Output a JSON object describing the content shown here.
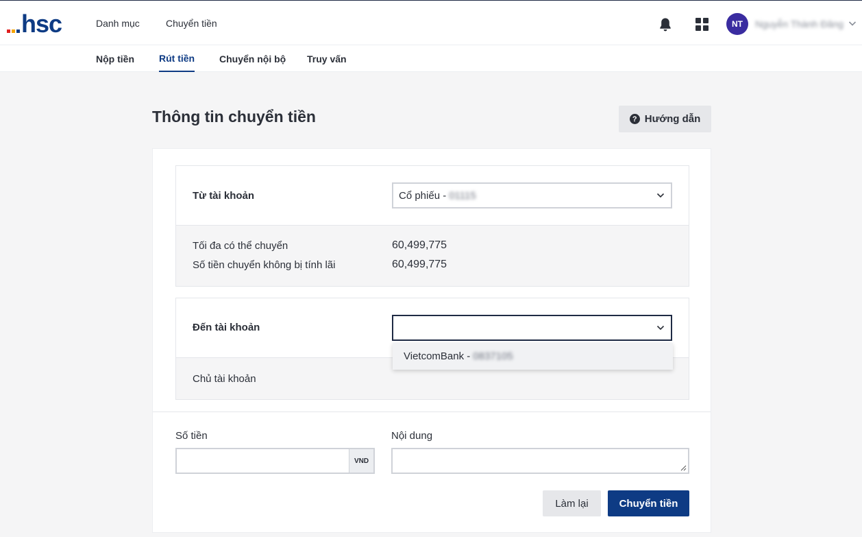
{
  "brand": {
    "logo_text": "hsc",
    "logo_bar_colors": [
      "#e02020",
      "#f5a400",
      "#0e3b84"
    ]
  },
  "header": {
    "nav": [
      "Danh mục",
      "Chuyển tiền"
    ],
    "user": {
      "initials": "NT",
      "name": "Nguyễn Thành Đăng",
      "avatar_color": "#3a2ca0"
    }
  },
  "subnav": {
    "tabs": [
      {
        "label": "Nộp tiền",
        "active": false
      },
      {
        "label": "Rút tiền",
        "active": true
      },
      {
        "label": "Chuyển nội bộ",
        "active": false
      },
      {
        "label": "Truy vấn",
        "active": false
      }
    ]
  },
  "page": {
    "title": "Thông tin chuyển tiền",
    "guide_button": "Hướng dẫn"
  },
  "from_account": {
    "label": "Từ tài khoản",
    "selected_prefix": "Cổ phiếu -",
    "selected_masked": "01115",
    "max_transfer_label": "Tối đa có thể chuyển",
    "max_transfer_value": "60,499,775",
    "interest_free_label": "Số tiền chuyển không bị tính lãi",
    "interest_free_value": "60,499,775"
  },
  "to_account": {
    "label": "Đến tài khoản",
    "selected": "",
    "option_prefix": "VietcomBank -",
    "option_masked": "0837105",
    "owner_label": "Chủ tài khoản"
  },
  "form": {
    "amount_label": "Số tiền",
    "amount_value": "",
    "currency": "VND",
    "content_label": "Nội dung",
    "content_value": "",
    "reset_button": "Làm lại",
    "submit_button": "Chuyển tiền"
  },
  "colors": {
    "primary": "#0e3b84",
    "background": "#f5f5f6",
    "border": "#cfd2d8"
  }
}
